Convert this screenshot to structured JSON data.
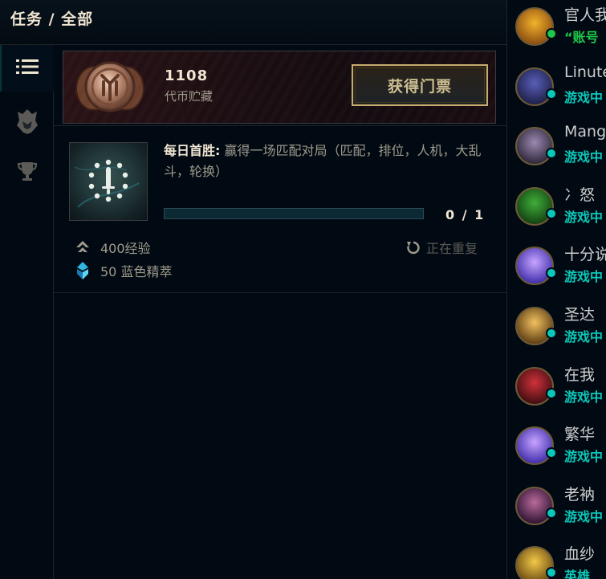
{
  "header": {
    "title": "任务 / 全部"
  },
  "rail": {
    "items": [
      {
        "name": "list-icon",
        "active": true
      },
      {
        "name": "champion-helmet-icon",
        "active": false
      },
      {
        "name": "trophy-icon",
        "active": false
      }
    ]
  },
  "token_banner": {
    "count": "1108",
    "label": "代币贮藏",
    "button_label": "获得门票",
    "coin_icon": "token-coin-icon"
  },
  "mission": {
    "title": "每日首胜:",
    "description": "赢得一场匹配对局（匹配，排位，人机，大乱斗，轮换）",
    "progress_text": "0 / 1",
    "progress_fraction": 0,
    "rewards": [
      {
        "icon": "experience-icon",
        "text": "400经验"
      },
      {
        "icon": "blue-essence-icon",
        "text": "50 蓝色精萃"
      }
    ],
    "repeat_label": "正在重复",
    "repeat_icon": "repeat-icon"
  },
  "friends": [
    {
      "name": "官人我",
      "status": "“账号",
      "status_color": "#1ec84b",
      "dot_color": "#1ec84b",
      "avatar_colors": [
        "#f2b32c",
        "#8a4b10"
      ]
    },
    {
      "name": "Linute",
      "status": "游戏中",
      "status_color": "#0ac8b9",
      "dot_color": "#0ac8b9",
      "avatar_colors": [
        "#5a5fb8",
        "#1b1d44"
      ]
    },
    {
      "name": "Mang",
      "status": "游戏中",
      "status_color": "#0ac8b9",
      "dot_color": "#0ac8b9",
      "avatar_colors": [
        "#9a8ab0",
        "#2a2235"
      ]
    },
    {
      "name": "冫怒",
      "status": "游戏中",
      "status_color": "#0ac8b9",
      "dot_color": "#0ac8b9",
      "avatar_colors": [
        "#3fae3a",
        "#123d10"
      ]
    },
    {
      "name": "十分说",
      "status": "游戏中",
      "status_color": "#0ac8b9",
      "dot_color": "#0ac8b9",
      "avatar_colors": [
        "#c7a4ff",
        "#3b2aa8"
      ]
    },
    {
      "name": "圣达",
      "status": "游戏中",
      "status_color": "#0ac8b9",
      "dot_color": "#0ac8b9",
      "avatar_colors": [
        "#f0c060",
        "#5a3a10"
      ]
    },
    {
      "name": "在我",
      "status": "游戏中",
      "status_color": "#0ac8b9",
      "dot_color": "#0ac8b9",
      "avatar_colors": [
        "#d0323a",
        "#3a0c10"
      ]
    },
    {
      "name": "繁华",
      "status": "游戏中",
      "status_color": "#0ac8b9",
      "dot_color": "#0ac8b9",
      "avatar_colors": [
        "#c7a4ff",
        "#3b2aa8"
      ]
    },
    {
      "name": "老衲",
      "status": "游戏中",
      "status_color": "#0ac8b9",
      "dot_color": "#0ac8b9",
      "avatar_colors": [
        "#b86a9a",
        "#2a1030"
      ]
    },
    {
      "name": "血纱",
      "status": "英雄",
      "status_color": "#0ac8b9",
      "dot_color": "#0ac8b9",
      "avatar_colors": [
        "#f2c84a",
        "#6a4a10"
      ]
    }
  ],
  "colors": {
    "background": "#010a13",
    "gold": "#c8aa6e",
    "text_light": "#f0e6d2",
    "text_muted": "#a09b8c",
    "teal": "#0ac8b9",
    "green": "#1ec84b"
  }
}
